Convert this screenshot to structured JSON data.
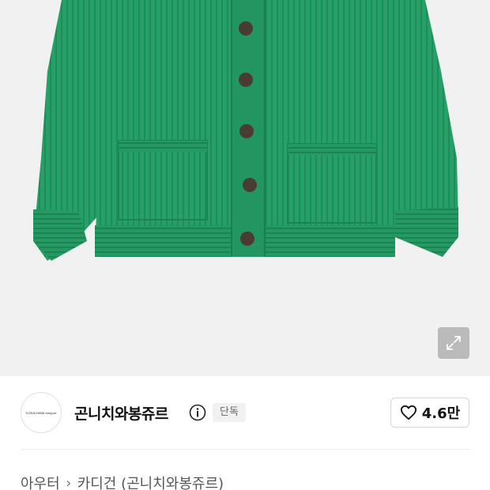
{
  "colors": {
    "sweater": "#27a067",
    "sweater_dark": "#1d8553",
    "button": "#4a3b33",
    "image_bg": "#f1f1f1"
  },
  "brand": {
    "logo_text": "CONICHIWA bonjour",
    "name": "곤니치와봉쥬르",
    "badge": "단독"
  },
  "like": {
    "count": "4.6만"
  },
  "breadcrumb": {
    "items": [
      "아우터",
      "카디건 (곤니치와봉쥬르)"
    ]
  }
}
